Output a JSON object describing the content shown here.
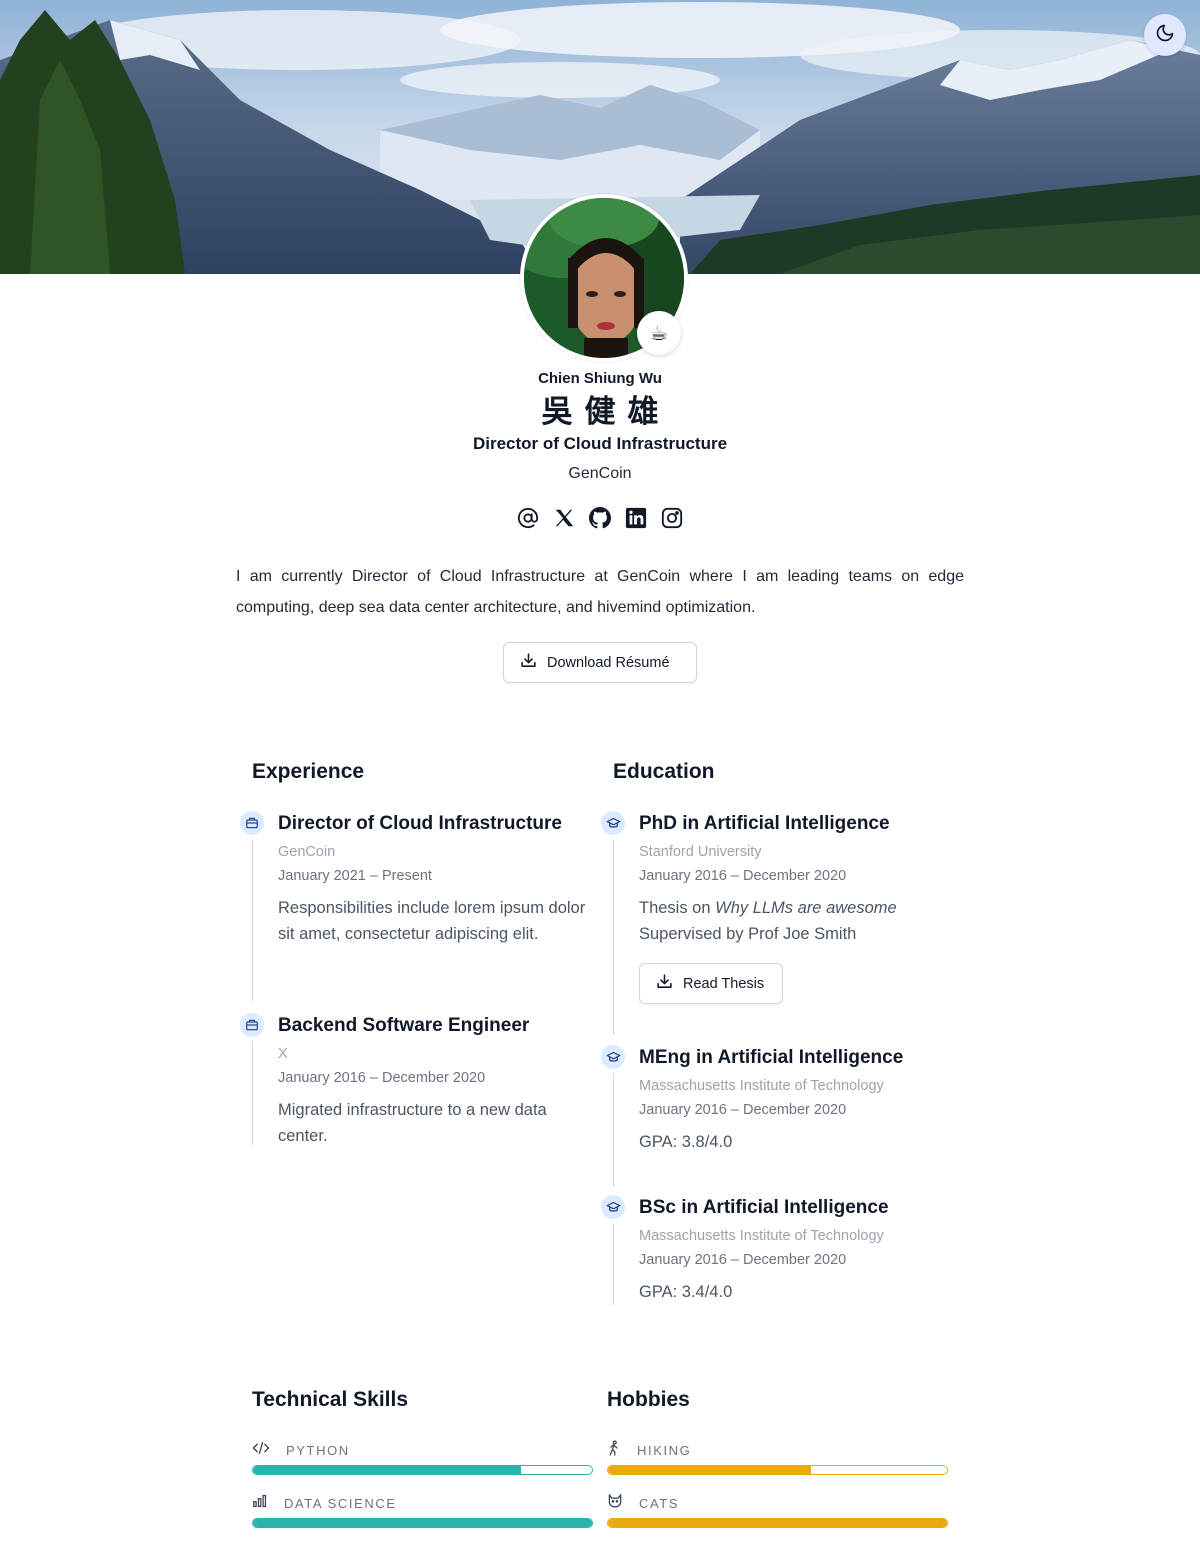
{
  "header": {
    "theme_toggle_icon": "moon-icon"
  },
  "profile": {
    "name": "Chien Shiung Wu",
    "name_native": "吳健雄",
    "role": "Director of Cloud Infrastructure",
    "organization": "GenCoin",
    "status_emoji": "☕",
    "bio": "I am currently Director of Cloud Infrastructure at GenCoin where I am leading teams on edge computing, deep sea data center architecture, and hivemind optimization.",
    "download_label": "Download Résumé",
    "socials": [
      "email-icon",
      "x-icon",
      "github-icon",
      "linkedin-icon",
      "instagram-icon"
    ]
  },
  "experience": {
    "title": "Experience",
    "items": [
      {
        "title": "Director of Cloud Infrastructure",
        "company": "GenCoin",
        "dates": "January 2021 – Present",
        "description": "Responsibilities include lorem ipsum dolor sit amet, consectetur adipiscing elit."
      },
      {
        "title": "Backend Software Engineer",
        "company": "X",
        "dates": "January 2016 – December 2020",
        "description": "Migrated infrastructure to a new data center."
      }
    ]
  },
  "education": {
    "title": "Education",
    "items": [
      {
        "title": "PhD in Artificial Intelligence",
        "institution": "Stanford University",
        "dates": "January 2016 – December 2020",
        "thesis_prefix": "Thesis on ",
        "thesis_title": "Why LLMs are awesome",
        "supervisor": "Supervised by Prof Joe Smith",
        "button_label": "Read Thesis"
      },
      {
        "title": "MEng in Artificial Intelligence",
        "institution": "Massachusetts Institute of Technology",
        "dates": "January 2016 – December 2020",
        "gpa": "GPA: 3.8/4.0"
      },
      {
        "title": "BSc in Artificial Intelligence",
        "institution": "Massachusetts Institute of Technology",
        "dates": "January 2016 – December 2020",
        "gpa": "GPA: 3.4/4.0"
      }
    ]
  },
  "skills": {
    "title": "Technical Skills",
    "color": "#2db3ad",
    "items": [
      {
        "label": "PYTHON",
        "icon": "code-icon",
        "level": 0.79
      },
      {
        "label": "DATA SCIENCE",
        "icon": "bar-chart-icon",
        "level": 1.0
      }
    ]
  },
  "hobbies": {
    "title": "Hobbies",
    "color": "#eaa90e",
    "items": [
      {
        "label": "HIKING",
        "icon": "hiking-icon",
        "level": 0.6
      },
      {
        "label": "CATS",
        "icon": "cat-icon",
        "level": 1.0
      }
    ]
  }
}
